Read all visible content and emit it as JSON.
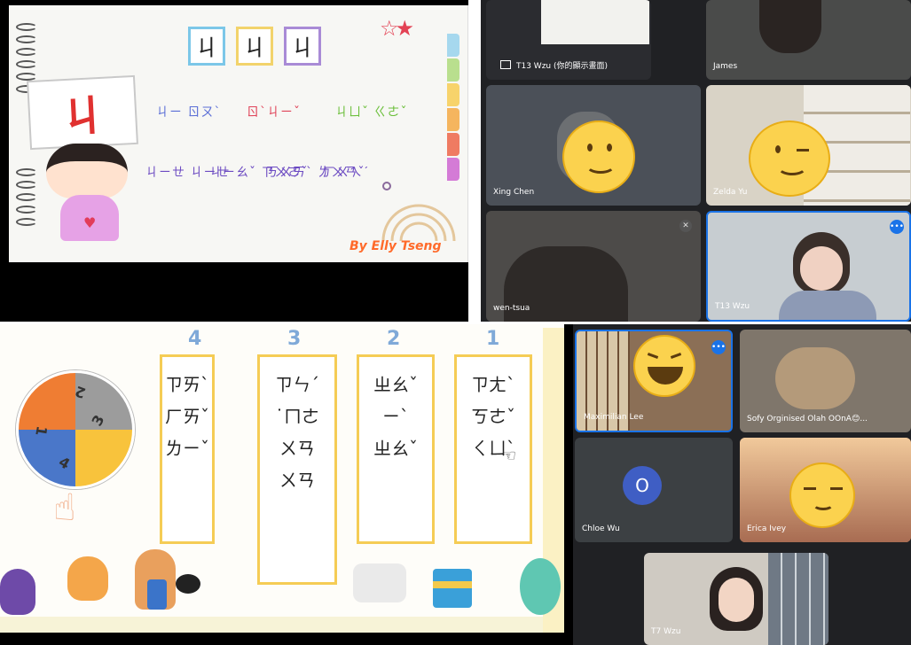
{
  "top_slide": {
    "header_chars": [
      "ㄐ",
      "ㄐ",
      "ㄐ"
    ],
    "card_char": "ㄐ",
    "rows": [
      [
        "ㄐㄧ ㄖㄡˋ",
        "ㄖˋㄐㄧˇ",
        "ㄐㄩˇ ㄍㄜˇ"
      ],
      [
        "ㄐㄧㄝ ㄐㄧㄝ",
        "ㄐㄧㄠˇ ㄗㄨㄛˇ",
        "ㄎㄨㄞˋ ㄌㄨㄢˇ",
        "ㄏㄨㄟˊ ㄐㄧㄚˇ"
      ]
    ],
    "byline": "By Elly Tseng"
  },
  "top_tiles": [
    {
      "name": "T13 Wzu (你的顯示畫面)"
    },
    {
      "name": "James"
    },
    {
      "name": "Xing Chen"
    },
    {
      "name": "Zelda Yu"
    },
    {
      "name": "wen-tsua"
    },
    {
      "name": "T13 Wzu"
    }
  ],
  "bottom_slide": {
    "columns": [
      {
        "number": "4",
        "syllables": [
          "ㄗㄞˋ",
          "ㄏㄞˇ",
          "ㄌㄧˇ"
        ]
      },
      {
        "number": "3",
        "syllables": [
          "ㄗㄣˊ",
          "˙ㄇㄜ",
          "ㄨㄢ",
          "ㄨㄢ"
        ]
      },
      {
        "number": "2",
        "syllables": [
          "ㄓㄠˇ",
          "ㄧˋ",
          "ㄓㄠˇ"
        ]
      },
      {
        "number": "1",
        "syllables": [
          "ㄗㄤˋ",
          "ㄎㄜˇ",
          "ㄑㄩˋ"
        ]
      }
    ],
    "wheel_numbers": [
      "1",
      "2",
      "3",
      "4"
    ]
  },
  "bottom_tiles": [
    {
      "name": "Maximilian Lee"
    },
    {
      "name": "Sofy Orginised Olah OOnA😊..."
    },
    {
      "name": "Chloe Wu",
      "avatar_letter": "O"
    },
    {
      "name": "Erica Ivey"
    },
    {
      "name": "T7 Wzu"
    }
  ],
  "colors": {
    "accent": "#1a73e8",
    "tile_bg": "#3c4043",
    "column_border": "#f5cc55"
  }
}
